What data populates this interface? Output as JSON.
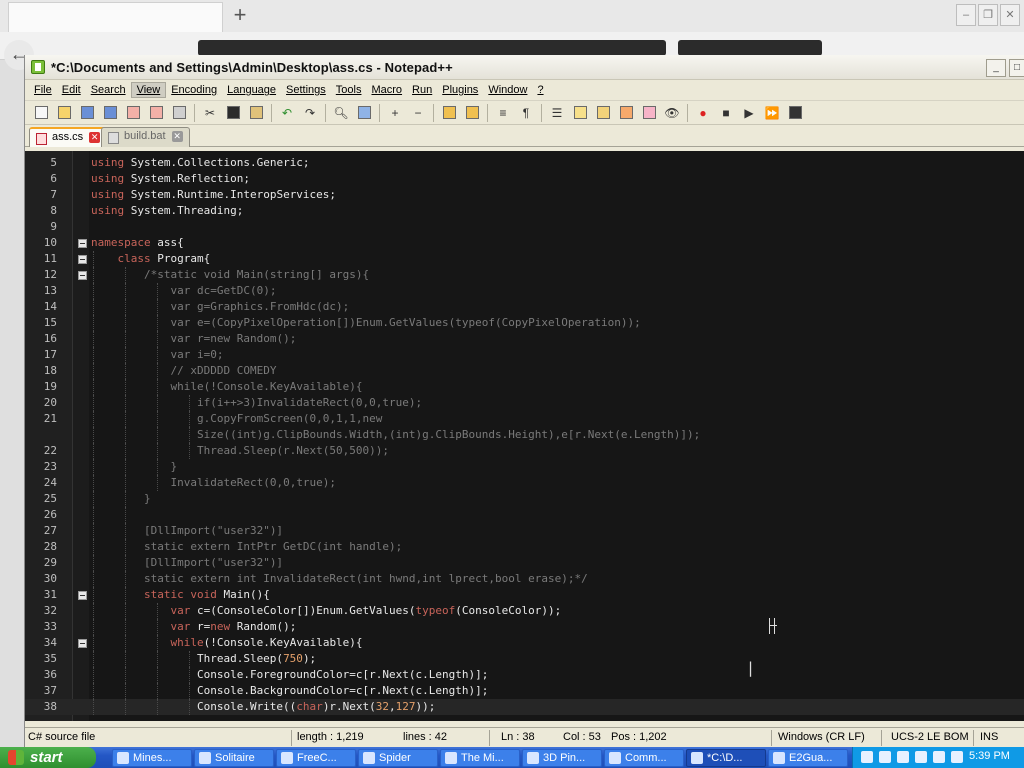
{
  "window": {
    "title": "*C:\\Documents and Settings\\Admin\\Desktop\\ass.cs - Notepad++"
  },
  "menu": [
    "File",
    "Edit",
    "Search",
    "View",
    "Encoding",
    "Language",
    "Settings",
    "Tools",
    "Macro",
    "Run",
    "Plugins",
    "Window",
    "?"
  ],
  "menu_active": "View",
  "tabs": [
    {
      "label": "ass.cs",
      "active": true
    },
    {
      "label": "build.bat",
      "active": false
    }
  ],
  "editor": {
    "lines": [
      {
        "n": "5",
        "fold": false,
        "guides": 0,
        "html": "<span class='kw'>using</span> System.Collections.Generic;"
      },
      {
        "n": "6",
        "fold": false,
        "guides": 0,
        "html": "<span class='kw'>using</span> System.Reflection;"
      },
      {
        "n": "7",
        "fold": false,
        "guides": 0,
        "html": "<span class='kw'>using</span> System.Runtime.InteropServices;"
      },
      {
        "n": "8",
        "fold": false,
        "guides": 0,
        "html": "<span class='kw'>using</span> System.Threading;"
      },
      {
        "n": "9",
        "fold": false,
        "guides": 0,
        "html": ""
      },
      {
        "n": "10",
        "fold": true,
        "guides": 0,
        "html": "<span class='kw'>namespace</span> ass{"
      },
      {
        "n": "11",
        "fold": true,
        "guides": 1,
        "html": "    <span class='kw'>class</span> Program{"
      },
      {
        "n": "12",
        "fold": true,
        "guides": 2,
        "html": "        <span class='cm'>/*static void Main(string[] args){</span>"
      },
      {
        "n": "13",
        "fold": false,
        "guides": 3,
        "html": "            <span class='cm'>var dc=GetDC(0);</span>"
      },
      {
        "n": "14",
        "fold": false,
        "guides": 3,
        "html": "            <span class='cm'>var g=Graphics.FromHdc(dc);</span>"
      },
      {
        "n": "15",
        "fold": false,
        "guides": 3,
        "html": "            <span class='cm'>var e=(CopyPixelOperation[])Enum.GetValues(typeof(CopyPixelOperation));</span>"
      },
      {
        "n": "16",
        "fold": false,
        "guides": 3,
        "html": "            <span class='cm'>var r=new Random();</span>"
      },
      {
        "n": "17",
        "fold": false,
        "guides": 3,
        "html": "            <span class='cm'>var i=0;</span>"
      },
      {
        "n": "18",
        "fold": false,
        "guides": 3,
        "html": "            <span class='cm'>// xDDDDD COMEDY</span>"
      },
      {
        "n": "19",
        "fold": false,
        "guides": 3,
        "html": "            <span class='cm'>while(!Console.KeyAvailable){</span>"
      },
      {
        "n": "20",
        "fold": false,
        "guides": 4,
        "html": "                <span class='cm'>if(i++>3)InvalidateRect(0,0,true);</span>"
      },
      {
        "n": "21",
        "fold": false,
        "guides": 4,
        "html": "                <span class='cm'>g.CopyFromScreen(0,0,1,1,new</span>"
      },
      {
        "n": "",
        "fold": false,
        "guides": 4,
        "html": "                <span class='cm'>Size((int)g.ClipBounds.Width,(int)g.ClipBounds.Height),e[r.Next(e.Length)]);</span>"
      },
      {
        "n": "22",
        "fold": false,
        "guides": 4,
        "html": "                <span class='cm'>Thread.Sleep(r.Next(50,500));</span>"
      },
      {
        "n": "23",
        "fold": false,
        "guides": 3,
        "html": "            <span class='cm'>}</span>"
      },
      {
        "n": "24",
        "fold": false,
        "guides": 3,
        "html": "            <span class='cm'>InvalidateRect(0,0,true);</span>"
      },
      {
        "n": "25",
        "fold": false,
        "guides": 2,
        "html": "        <span class='cm'>}</span>"
      },
      {
        "n": "26",
        "fold": false,
        "guides": 2,
        "html": ""
      },
      {
        "n": "27",
        "fold": false,
        "guides": 2,
        "html": "        <span class='cm'>[DllImport(\"user32\")]</span>"
      },
      {
        "n": "28",
        "fold": false,
        "guides": 2,
        "html": "        <span class='cm'>static extern IntPtr GetDC(int handle);</span>"
      },
      {
        "n": "29",
        "fold": false,
        "guides": 2,
        "html": "        <span class='cm'>[DllImport(\"user32\")]</span>"
      },
      {
        "n": "30",
        "fold": false,
        "guides": 2,
        "html": "        <span class='cm'>static extern int InvalidateRect(int hwnd,int lprect,bool erase);*/</span>"
      },
      {
        "n": "31",
        "fold": true,
        "guides": 2,
        "html": "        <span class='kw'>static</span> <span class='kw'>void</span> Main(){"
      },
      {
        "n": "32",
        "fold": false,
        "guides": 3,
        "html": "            <span class='kw'>var</span> c=(ConsoleColor[])Enum.GetValues(<span class='kw'>typeof</span>(ConsoleColor));"
      },
      {
        "n": "33",
        "fold": false,
        "guides": 3,
        "html": "            <span class='kw'>var</span> r=<span class='kw'>new</span> Random();"
      },
      {
        "n": "34",
        "fold": true,
        "guides": 3,
        "html": "            <span class='kw'>while</span>(!Console.KeyAvailable){"
      },
      {
        "n": "35",
        "fold": false,
        "guides": 4,
        "html": "                Thread.Sleep(<span class='num'>750</span>);"
      },
      {
        "n": "36",
        "fold": false,
        "guides": 4,
        "html": "                Console.ForegroundColor=c[r.Next(c.Length)];"
      },
      {
        "n": "37",
        "fold": false,
        "guides": 4,
        "html": "                Console.BackgroundColor=c[r.Next(c.Length)];"
      },
      {
        "n": "38",
        "fold": false,
        "guides": 4,
        "html": "                Console.Write((<span class='kw'>char</span>)r.Next(<span class='num'>32</span>,<span class='num'>127</span>));",
        "current": true
      }
    ]
  },
  "status": {
    "filetype": "C# source file",
    "length": "length : 1,219",
    "lines": "lines : 42",
    "ln": "Ln : 38",
    "col": "Col : 53",
    "pos": "Pos : 1,202",
    "eol": "Windows (CR LF)",
    "encoding": "UCS-2 LE BOM",
    "ins": "INS"
  },
  "taskbar": {
    "start": "start",
    "items": [
      {
        "label": "Mines...",
        "active": false
      },
      {
        "label": "Solitaire",
        "active": false
      },
      {
        "label": "FreeC...",
        "active": false
      },
      {
        "label": "Spider",
        "active": false
      },
      {
        "label": "The Mi...",
        "active": false
      },
      {
        "label": "3D Pin...",
        "active": false
      },
      {
        "label": "Comm...",
        "active": false
      },
      {
        "label": "*C:\\D...",
        "active": true
      },
      {
        "label": "E2Gua...",
        "active": false
      }
    ],
    "clock": "5:39 PM"
  },
  "colors": {
    "keyword": "#c8645a",
    "comment": "#7a7a7a",
    "number": "#e4a06a",
    "editor_bg": "#161616",
    "tab_accent": "#f5a623",
    "taskbar": "#2457c5",
    "start_green": "#3a9b3a"
  }
}
